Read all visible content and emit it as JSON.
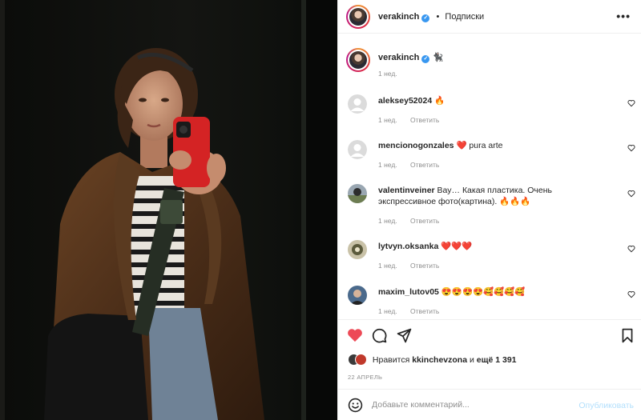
{
  "post": {
    "author": "verakinch",
    "follow_label": "Подписки",
    "dot": "•",
    "more_icon": "ellipsis-icon",
    "verified_icon": "verified-badge-icon"
  },
  "caption": {
    "author": "verakinch",
    "text": "🐈‍⬛",
    "time": "1 нед."
  },
  "comments": [
    {
      "user": "aleksey52024",
      "text": "🔥",
      "time": "1 нед.",
      "reply": "Ответить",
      "avatar": "default"
    },
    {
      "user": "mencionogonzales",
      "text": "❤️ pura arte",
      "time": "1 нед.",
      "reply": "Ответить",
      "avatar": "default"
    },
    {
      "user": "valentinveiner",
      "text": "Вау… Какая пластика. Очень экспрессивное фото(картина). 🔥🔥🔥",
      "time": "1 нед.",
      "reply": "Ответить",
      "avatar": "photo"
    },
    {
      "user": "lytvyn.oksanka",
      "text": "❤️❤️❤️",
      "time": "1 нед.",
      "reply": "Ответить",
      "avatar": "photo"
    },
    {
      "user": "maxim_lutov05",
      "text": "😍😍😍😍🥰🥰🥰🥰",
      "time": "1 нед.",
      "reply": "Ответить",
      "avatar": "photo"
    }
  ],
  "actions": {
    "like_icon": "heart-filled-icon",
    "comment_icon": "comment-bubble-icon",
    "share_icon": "paper-plane-icon",
    "save_icon": "bookmark-icon",
    "liked_color": "#ed4956"
  },
  "likes": {
    "prefix": "Нравится",
    "user": "kkinchevzona",
    "middle": "и",
    "count": "ещё 1 391"
  },
  "date": "22 АПРЕЛЬ",
  "add_comment": {
    "placeholder": "Добавьте комментарий...",
    "publish_label": "Опубликовать",
    "emoji_icon": "smiley-icon"
  },
  "colors": {
    "accent_blue": "#3897f0",
    "publish_disabled": "#b2dffc",
    "secondary_text": "#8e8e8e"
  }
}
